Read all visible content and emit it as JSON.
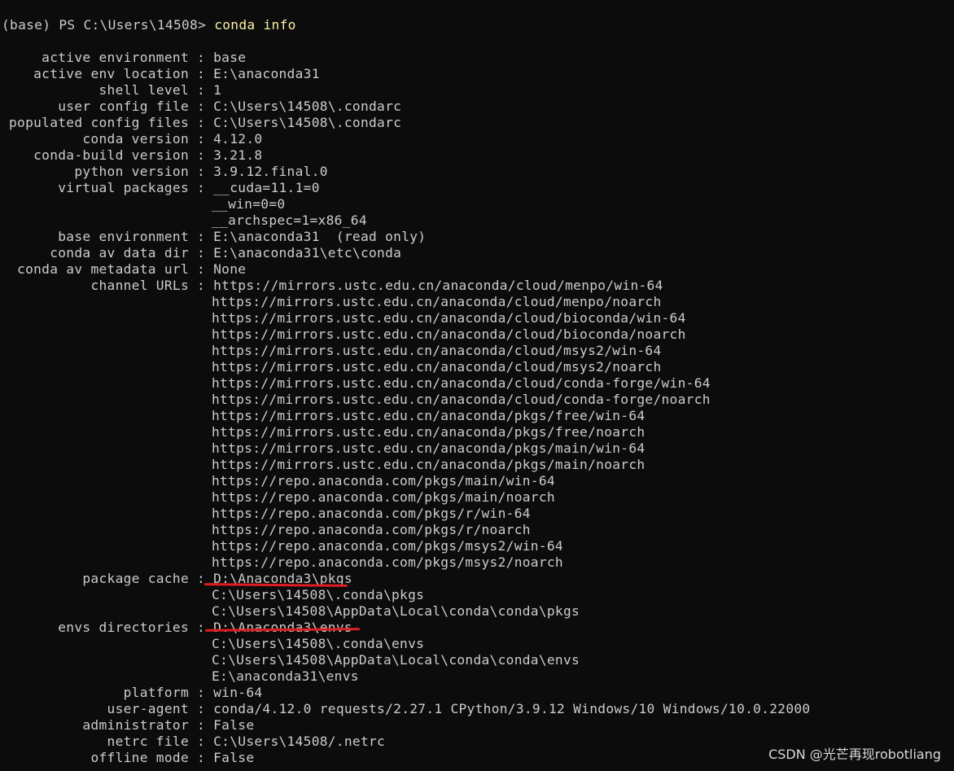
{
  "prompt": {
    "text": "(base) PS C:\\Users\\14508> ",
    "command": "conda info"
  },
  "info": [
    {
      "label": "active environment",
      "values": [
        "base"
      ]
    },
    {
      "label": "active env location",
      "values": [
        "E:\\anaconda31"
      ]
    },
    {
      "label": "shell level",
      "values": [
        "1"
      ]
    },
    {
      "label": "user config file",
      "values": [
        "C:\\Users\\14508\\.condarc"
      ]
    },
    {
      "label": "populated config files",
      "values": [
        "C:\\Users\\14508\\.condarc"
      ]
    },
    {
      "label": "conda version",
      "values": [
        "4.12.0"
      ]
    },
    {
      "label": "conda-build version",
      "values": [
        "3.21.8"
      ]
    },
    {
      "label": "python version",
      "values": [
        "3.9.12.final.0"
      ]
    },
    {
      "label": "virtual packages",
      "values": [
        "__cuda=11.1=0",
        "__win=0=0",
        "__archspec=1=x86_64"
      ]
    },
    {
      "label": "base environment",
      "values": [
        "E:\\anaconda31  (read only)"
      ]
    },
    {
      "label": "conda av data dir",
      "values": [
        "E:\\anaconda31\\etc\\conda"
      ]
    },
    {
      "label": "conda av metadata url",
      "values": [
        "None"
      ]
    },
    {
      "label": "channel URLs",
      "values": [
        "https://mirrors.ustc.edu.cn/anaconda/cloud/menpo/win-64",
        "https://mirrors.ustc.edu.cn/anaconda/cloud/menpo/noarch",
        "https://mirrors.ustc.edu.cn/anaconda/cloud/bioconda/win-64",
        "https://mirrors.ustc.edu.cn/anaconda/cloud/bioconda/noarch",
        "https://mirrors.ustc.edu.cn/anaconda/cloud/msys2/win-64",
        "https://mirrors.ustc.edu.cn/anaconda/cloud/msys2/noarch",
        "https://mirrors.ustc.edu.cn/anaconda/cloud/conda-forge/win-64",
        "https://mirrors.ustc.edu.cn/anaconda/cloud/conda-forge/noarch",
        "https://mirrors.ustc.edu.cn/anaconda/pkgs/free/win-64",
        "https://mirrors.ustc.edu.cn/anaconda/pkgs/free/noarch",
        "https://mirrors.ustc.edu.cn/anaconda/pkgs/main/win-64",
        "https://mirrors.ustc.edu.cn/anaconda/pkgs/main/noarch",
        "https://repo.anaconda.com/pkgs/main/win-64",
        "https://repo.anaconda.com/pkgs/main/noarch",
        "https://repo.anaconda.com/pkgs/r/win-64",
        "https://repo.anaconda.com/pkgs/r/noarch",
        "https://repo.anaconda.com/pkgs/msys2/win-64",
        "https://repo.anaconda.com/pkgs/msys2/noarch"
      ]
    },
    {
      "label": "package cache",
      "values": [
        "D:\\Anaconda3\\pkgs",
        "C:\\Users\\14508\\.conda\\pkgs",
        "C:\\Users\\14508\\AppData\\Local\\conda\\conda\\pkgs"
      ]
    },
    {
      "label": "envs directories",
      "values": [
        "D:\\Anaconda3\\envs",
        "C:\\Users\\14508\\.conda\\envs",
        "C:\\Users\\14508\\AppData\\Local\\conda\\conda\\envs",
        "E:\\anaconda31\\envs"
      ]
    },
    {
      "label": "platform",
      "values": [
        "win-64"
      ]
    },
    {
      "label": "user-agent",
      "values": [
        "conda/4.12.0 requests/2.27.1 CPython/3.9.12 Windows/10 Windows/10.0.22000"
      ]
    },
    {
      "label": "administrator",
      "values": [
        "False"
      ]
    },
    {
      "label": "netrc file",
      "values": [
        "C:\\Users\\14508/.netrc"
      ]
    },
    {
      "label": "offline mode",
      "values": [
        "False"
      ]
    }
  ],
  "separator": " : ",
  "watermark": "CSDN @光芒再现robotliang",
  "colors": {
    "background": "#0c0c0c",
    "text": "#cccccc",
    "command": "#f9f1a5",
    "annotation": "#e11d22"
  }
}
